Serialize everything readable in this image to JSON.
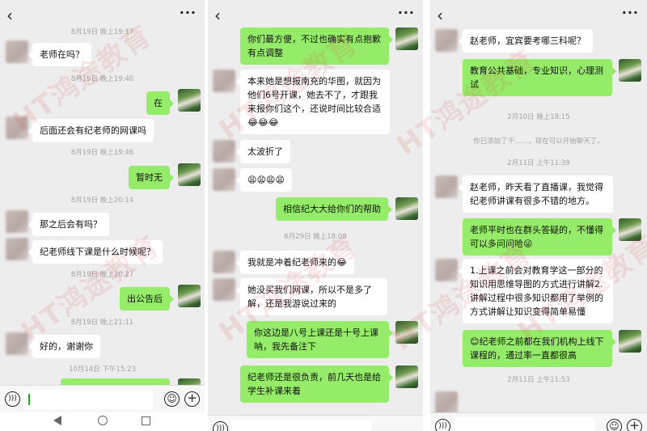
{
  "watermark": "HT鸿途教育",
  "panels": [
    {
      "more_label": "···",
      "messages": [
        {
          "kind": "timestamp",
          "text": "8月19日 晚上19:17"
        },
        {
          "kind": "in",
          "text": "老师在吗？"
        },
        {
          "kind": "timestamp",
          "text": "8月19日 晚上19:40"
        },
        {
          "kind": "out",
          "text": "在"
        },
        {
          "kind": "in",
          "text": "后面还会有纪老师的网课吗"
        },
        {
          "kind": "timestamp",
          "text": "8月19日 晚上19:46"
        },
        {
          "kind": "out",
          "text": "暂时无"
        },
        {
          "kind": "timestamp",
          "text": "8月19日 晚上20:14"
        },
        {
          "kind": "in",
          "text": "那之后会有吗？"
        },
        {
          "kind": "in",
          "text": "纪老师线下课是什么时候呢？"
        },
        {
          "kind": "timestamp",
          "text": "8月19日 晚上20:27"
        },
        {
          "kind": "out",
          "text": "出公告后"
        },
        {
          "kind": "timestamp",
          "text": "8月19日 晚上21:11"
        },
        {
          "kind": "in",
          "text": "好的，谢谢你"
        },
        {
          "kind": "timestamp",
          "text": "10月14日 下午15:23"
        }
      ]
    },
    {
      "more_label": "···",
      "messages": [
        {
          "kind": "out",
          "text": "你们最方便，不过也确实有点抱歉有点调整"
        },
        {
          "kind": "in",
          "text": "本来她是想报南充的华图，就因为他们6号开课，她去不了，才跟我来报你们这个，还说时间比较合适😂😂😂"
        },
        {
          "kind": "in",
          "text": "太波折了"
        },
        {
          "kind": "in",
          "text": "😩😩😩😩"
        },
        {
          "kind": "out",
          "text": "相信纪大大给你们的帮助"
        },
        {
          "kind": "timestamp",
          "text": "6月29日 晚上18:08"
        },
        {
          "kind": "in",
          "text": "我就是冲着纪老师来的😂"
        },
        {
          "kind": "in",
          "text": "她没买我们网课，所以不是多了解，还是我游说过来的"
        },
        {
          "kind": "out",
          "text": "你这边是八号上课还是十号上课呐，我先备注下"
        },
        {
          "kind": "out",
          "text": "纪老师还是很负责，前几天也是给学生补课来着"
        }
      ]
    },
    {
      "more_label": "···",
      "messages": [
        {
          "kind": "in",
          "text": "赵老师，宜宾要考哪三科呢？"
        },
        {
          "kind": "out",
          "text": "教育公共基础，专业知识，心理测试"
        },
        {
          "kind": "timestamp",
          "text": "2月10日 晚上18:15"
        },
        {
          "kind": "system",
          "text": "你已添加了千……，现在可以开始聊天了。"
        },
        {
          "kind": "timestamp",
          "text": "2月11日 上午11:39"
        },
        {
          "kind": "in",
          "text": "赵老师，昨天看了直播课，我觉得纪老师讲课有很多不错的地方。"
        },
        {
          "kind": "out",
          "text": "老师平时也在群头答疑的，不懂得可以多问问哈😜"
        },
        {
          "kind": "in",
          "text": "1.上课之前会对教育学这一部分的知识用思维导图的方式进行讲解2.讲解过程中很多知识都用了举例的方式讲解让知识变得简单易懂"
        },
        {
          "kind": "out",
          "text": "😊纪老师之前都在我们机构上线下课程的，通过率一直都很高"
        },
        {
          "kind": "timestamp",
          "text": "2月11日 上午11:53"
        }
      ]
    }
  ]
}
